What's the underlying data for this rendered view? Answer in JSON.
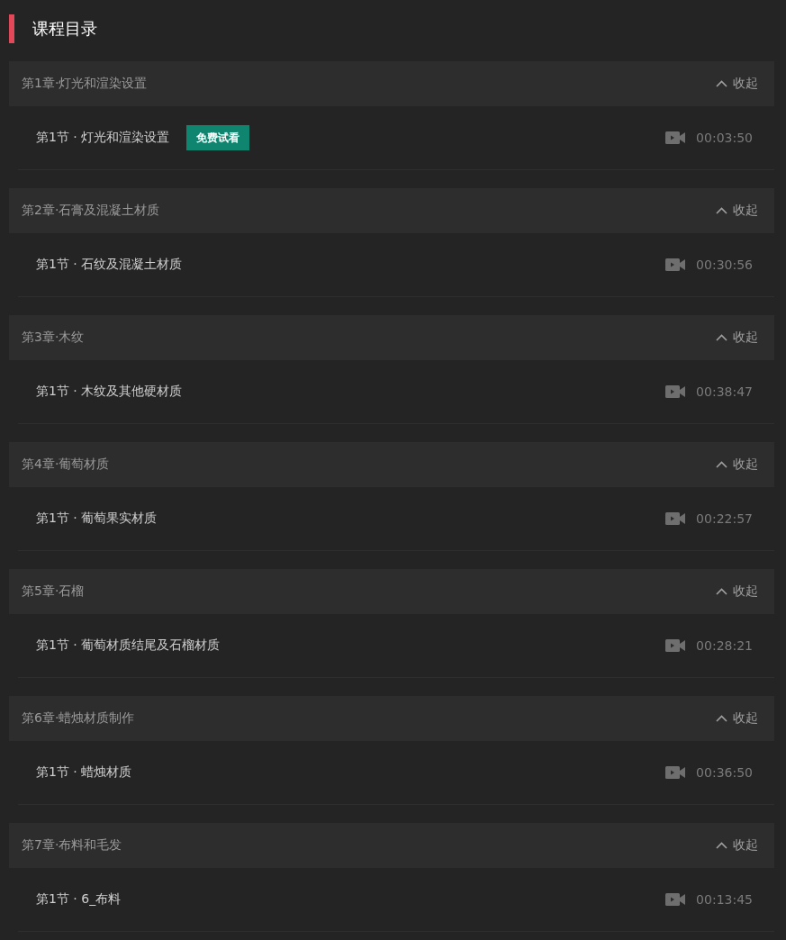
{
  "header": {
    "title": "课程目录"
  },
  "chapters": [
    {
      "title": "第1章·灯光和渲染设置",
      "toggle": "收起",
      "expanded": true,
      "lessons": [
        {
          "title": "第1节 · 灯光和渲染设置",
          "badge": "免费试看",
          "duration": "00:03:50"
        }
      ]
    },
    {
      "title": "第2章·石膏及混凝土材质",
      "toggle": "收起",
      "expanded": true,
      "lessons": [
        {
          "title": "第1节 · 石纹及混凝土材质",
          "duration": "00:30:56"
        }
      ]
    },
    {
      "title": "第3章·木纹",
      "toggle": "收起",
      "expanded": true,
      "lessons": [
        {
          "title": "第1节 · 木纹及其他硬材质",
          "duration": "00:38:47"
        }
      ]
    },
    {
      "title": "第4章·葡萄材质",
      "toggle": "收起",
      "expanded": true,
      "lessons": [
        {
          "title": "第1节 · 葡萄果实材质",
          "duration": "00:22:57"
        }
      ]
    },
    {
      "title": "第5章·石榴",
      "toggle": "收起",
      "expanded": true,
      "lessons": [
        {
          "title": "第1节 · 葡萄材质结尾及石榴材质",
          "duration": "00:28:21"
        }
      ]
    },
    {
      "title": "第6章·蜡烛材质制作",
      "toggle": "收起",
      "expanded": true,
      "lessons": [
        {
          "title": "第1节 · 蜡烛材质",
          "duration": "00:36:50"
        }
      ]
    },
    {
      "title": "第7章·布料和毛发",
      "toggle": "收起",
      "expanded": true,
      "lessons": [
        {
          "title": "第1节 · 6_布料",
          "duration": "00:13:45"
        }
      ]
    }
  ]
}
